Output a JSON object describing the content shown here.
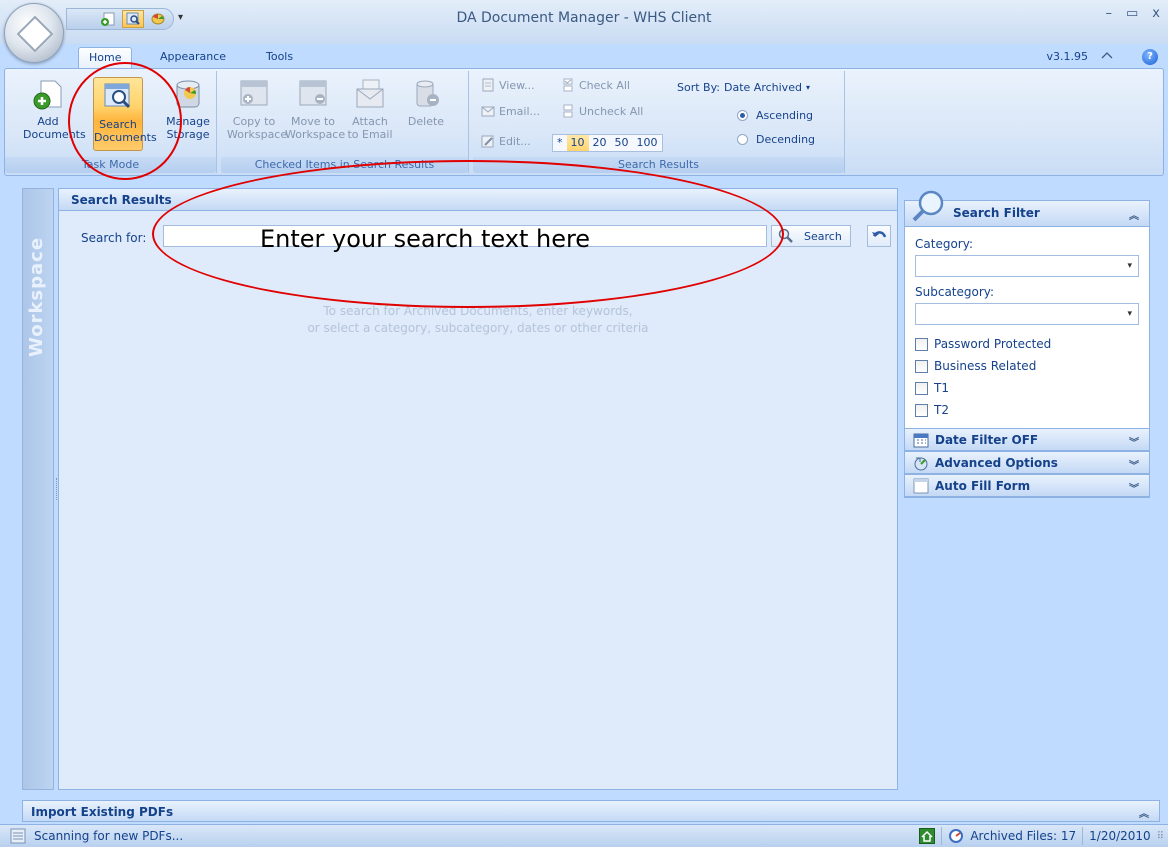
{
  "window": {
    "title": "DA Document Manager - WHS Client",
    "version": "v3.1.95"
  },
  "tabs": [
    {
      "label": "Home"
    },
    {
      "label": "Appearance"
    },
    {
      "label": "Tools"
    }
  ],
  "ribbon": {
    "task_mode": {
      "label": "Task Mode",
      "add_line1": "Add",
      "add_line2": "Documents",
      "search_line1": "Search",
      "search_line2": "Documents",
      "manage_line1": "Manage",
      "manage_line2": "Storage"
    },
    "checked_items": {
      "label": "Checked Items in Search Results",
      "copy_line1": "Copy to",
      "copy_line2": "Workspace",
      "move_line1": "Move to",
      "move_line2": "Workspace",
      "attach_line1": "Attach",
      "attach_line2": "to Email",
      "delete_line1": "Delete"
    },
    "search_results": {
      "label": "Search Results",
      "view": "View...",
      "email": "Email...",
      "edit": "Edit...",
      "check_all": "Check All",
      "uncheck_all": "Uncheck All",
      "paging": [
        "*",
        "10",
        "20",
        "50",
        "100"
      ],
      "paging_selected": "10",
      "sort_by_label": "Sort By:",
      "sort_by_value": "Date Archived",
      "ascending": "Ascending",
      "descending": "Decending",
      "order_selected": "Ascending"
    }
  },
  "workspace_label": "Workspace",
  "results_panel": {
    "title": "Search Results",
    "search_label": "Search for:",
    "search_value": "",
    "search_button": "Search",
    "hint_line1": "To search for Archived Documents, enter keywords,",
    "hint_line2": "or select a category, subcategory, dates or other criteria"
  },
  "annotation": {
    "text": "Enter your search text here",
    "color": "#e00000"
  },
  "filter": {
    "title": "Search Filter",
    "category_label": "Category:",
    "category_value": "",
    "subcategory_label": "Subcategory:",
    "subcategory_value": "",
    "checkboxes": [
      {
        "label": "Password Protected",
        "checked": false
      },
      {
        "label": "Business Related",
        "checked": false
      },
      {
        "label": "T1",
        "checked": false
      },
      {
        "label": "T2",
        "checked": false
      }
    ],
    "sections": [
      {
        "label": "Date Filter OFF",
        "icon": "calendar-icon"
      },
      {
        "label": "Advanced Options",
        "icon": "options-icon"
      },
      {
        "label": "Auto Fill Form",
        "icon": "form-icon"
      }
    ]
  },
  "import_bar": {
    "title": "Import Existing PDFs"
  },
  "status": {
    "text": "Scanning for new PDFs...",
    "archived": "Archived Files: 17",
    "date": "1/20/2010"
  },
  "colors": {
    "accent": "#15428b",
    "active_button": "#ffc44f",
    "annotation": "#e00000"
  }
}
